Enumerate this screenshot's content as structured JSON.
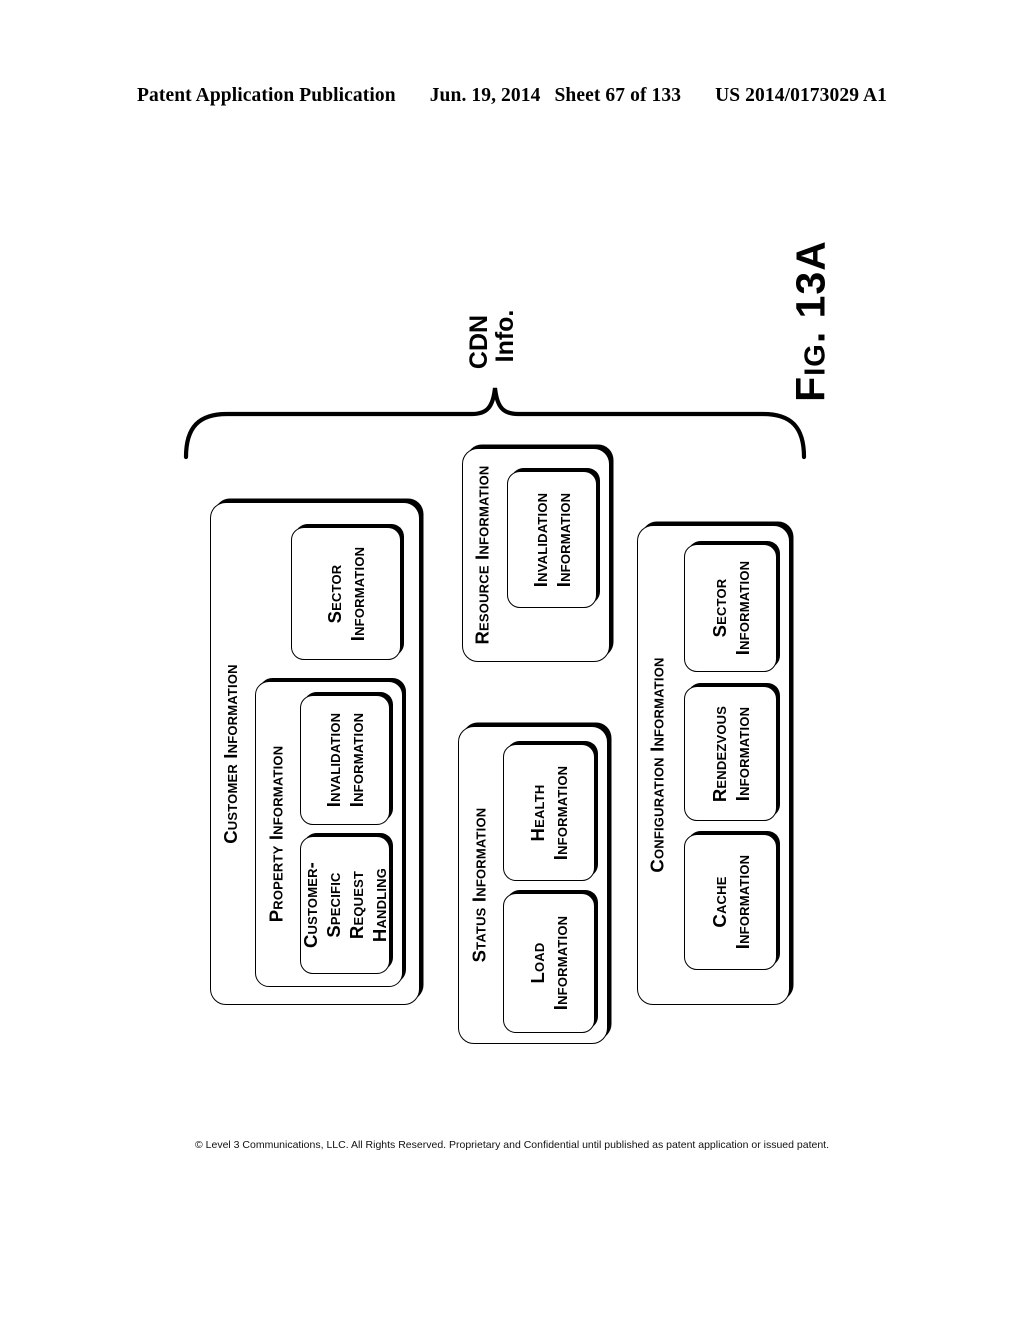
{
  "header": {
    "publication": "Patent Application Publication",
    "date": "Jun. 19, 2014",
    "sheet": "Sheet 67 of 133",
    "patent_number": "US 2014/0173029 A1"
  },
  "footer": {
    "copyright": "© Level 3 Communications, LLC.  All Rights Reserved.  Proprietary and Confidential until published as patent application or issued patent."
  },
  "figure": {
    "label": "Fig. 13A",
    "brace_label_line1": "CDN",
    "brace_label_line2": "Info."
  },
  "diagram": {
    "customer_information": {
      "title": "Customer Information",
      "sector_information": "Sector",
      "sector_information_2": "Information",
      "property_information": {
        "title": "Property Information",
        "invalidation_line1": "Invalidation",
        "invalidation_line2": "Information",
        "csrh_line1": "Customer-",
        "csrh_line2": "Specific",
        "csrh_line3": "Request",
        "csrh_line4": "Handling"
      }
    },
    "resource_information": {
      "title": "Resource Information",
      "invalidation_line1": "Invalidation",
      "invalidation_line2": "Information"
    },
    "status_information": {
      "title": "Status Information",
      "health_line1": "Health",
      "health_line2": "Information",
      "load_line1": "Load",
      "load_line2": "Information"
    },
    "configuration_information": {
      "title": "Configuration Information",
      "sector_line1": "Sector",
      "sector_line2": "Information",
      "rendezvous_line1": "Rendezvous",
      "rendezvous_line2": "Information",
      "cache_line1": "Cache",
      "cache_line2": "Information"
    }
  },
  "colors": {
    "ink": "#000000",
    "paper": "#ffffff"
  }
}
